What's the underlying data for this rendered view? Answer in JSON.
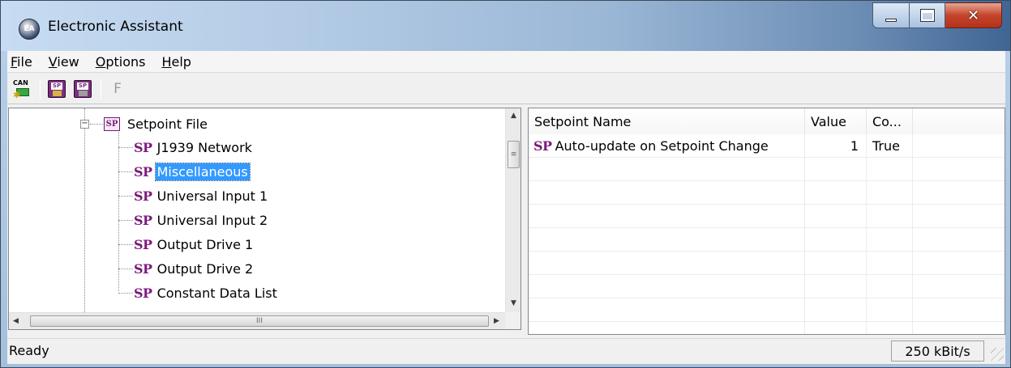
{
  "window": {
    "title": "Electronic Assistant",
    "app_icon_text": "EA"
  },
  "menu": [
    {
      "pre": "",
      "u": "F",
      "post": "ile"
    },
    {
      "pre": "",
      "u": "V",
      "post": "iew"
    },
    {
      "pre": "",
      "u": "O",
      "post": "ptions"
    },
    {
      "pre": "",
      "u": "H",
      "post": "elp"
    }
  ],
  "toolbar": {
    "can_icon_text": "CAN",
    "disk_icon_text": "SP",
    "f_label": "F"
  },
  "tree": {
    "root_label": "Setpoint File",
    "root_icon_text": "SP",
    "node_icon_text": "SP",
    "items": [
      {
        "label": "J1939 Network",
        "selected": false
      },
      {
        "label": "Miscellaneous",
        "selected": true
      },
      {
        "label": "Universal Input 1",
        "selected": false
      },
      {
        "label": "Universal Input 2",
        "selected": false
      },
      {
        "label": "Output Drive 1",
        "selected": false
      },
      {
        "label": "Output Drive 2",
        "selected": false
      },
      {
        "label": "Constant Data List",
        "selected": false
      }
    ]
  },
  "scrollbar": {
    "grip_glyph": "≡",
    "hgrip_glyph": "III"
  },
  "list": {
    "columns": [
      "Setpoint Name",
      "Value",
      "Co..."
    ],
    "rows": [
      {
        "icon_text": "SP",
        "name": "Auto-update on Setpoint Change",
        "value": "1",
        "co": "True"
      }
    ]
  },
  "status": {
    "text": "Ready",
    "baud": "250 kBit/s"
  },
  "colors": {
    "selection": "#3399ff",
    "sp_purple": "#7a1a7a",
    "close_red": "#c4452b"
  }
}
